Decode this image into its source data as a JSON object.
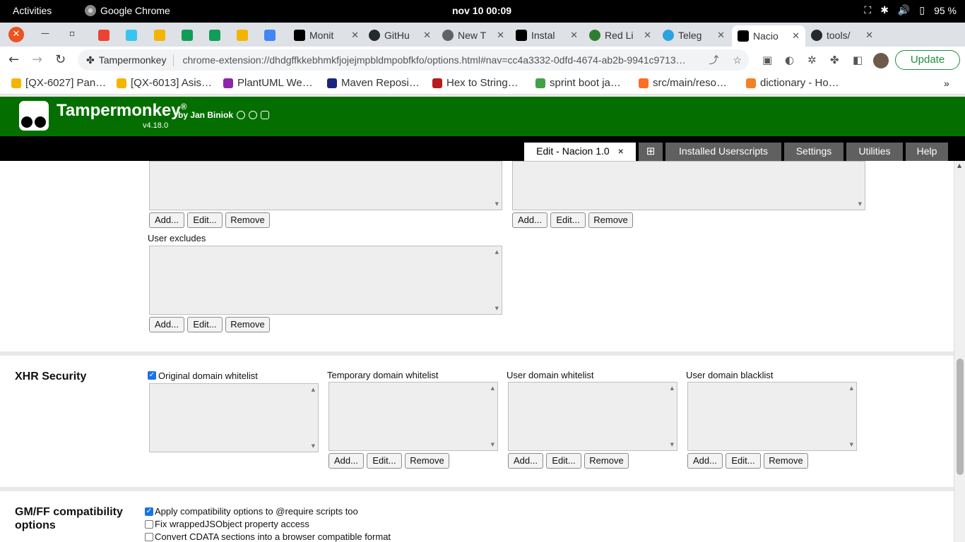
{
  "system": {
    "activities": "Activities",
    "app_name": "Google Chrome",
    "clock": "nov 10  00:09",
    "battery": "95 %"
  },
  "tabs": [
    {
      "label": "Monit",
      "color": "#000000"
    },
    {
      "label": "GitHu",
      "color": "#24292e"
    },
    {
      "label": "New T",
      "color": "#5f6368"
    },
    {
      "label": "Instal",
      "color": "#000000"
    },
    {
      "label": "Red Li",
      "color": "#2e7d32"
    },
    {
      "label": "Teleg",
      "color": "#2aa3e0"
    },
    {
      "label": "Nacio",
      "color": "#000000"
    },
    {
      "label": "tools/",
      "color": "#24292e"
    }
  ],
  "addressbar": {
    "chip": "Tampermonkey",
    "url": "chrome-extension://dhdgffkkebhmkfjojejmpbldmpobfkfo/options.html#nav=cc4a3332-0dfd-4674-ab2b-9941c9713…",
    "update": "Update"
  },
  "bookmarks": [
    {
      "label": "[QX-6027] Pan…",
      "color": "#f4b400"
    },
    {
      "label": "[QX-6013] Asis…",
      "color": "#f4b400"
    },
    {
      "label": "PlantUML We…",
      "color": "#8e24aa"
    },
    {
      "label": "Maven Reposi…",
      "color": "#1a237e"
    },
    {
      "label": "Hex to String…",
      "color": "#b71c1c"
    },
    {
      "label": "sprint boot ja…",
      "color": "#43a047"
    },
    {
      "label": "src/main/reso…",
      "color": "#fc6d26"
    },
    {
      "label": "dictionary - Ho…",
      "color": "#f48024"
    }
  ],
  "tm": {
    "title": "Tampermonkey",
    "reg": "®",
    "by": "by Jan Biniok",
    "version": "v4.18.0",
    "tab_edit": "Edit - Nacion 1.0",
    "tab_close": "×",
    "tab_add": "⊞",
    "tab_installed": "Installed Userscripts",
    "tab_settings": "Settings",
    "tab_utilities": "Utilities",
    "tab_help": "Help",
    "brand_color": "#046f00"
  },
  "buttons": {
    "add": "Add...",
    "edit": "Edit...",
    "remove": "Remove"
  },
  "includes": {
    "user_excludes": "User excludes"
  },
  "xhr": {
    "title": "XHR Security",
    "original": "Original domain whitelist",
    "original_checked": true,
    "temporary": "Temporary domain whitelist",
    "user_whitelist": "User domain whitelist",
    "user_blacklist": "User domain blacklist"
  },
  "compat": {
    "title": "GM/FF compatibility options",
    "opt1": "Apply compatibility options to @require scripts too",
    "opt1_checked": true,
    "opt2": "Fix wrappedJSObject property access",
    "opt2_checked": false,
    "opt3": "Convert CDATA sections into a browser compatible format",
    "opt3_checked": false
  }
}
